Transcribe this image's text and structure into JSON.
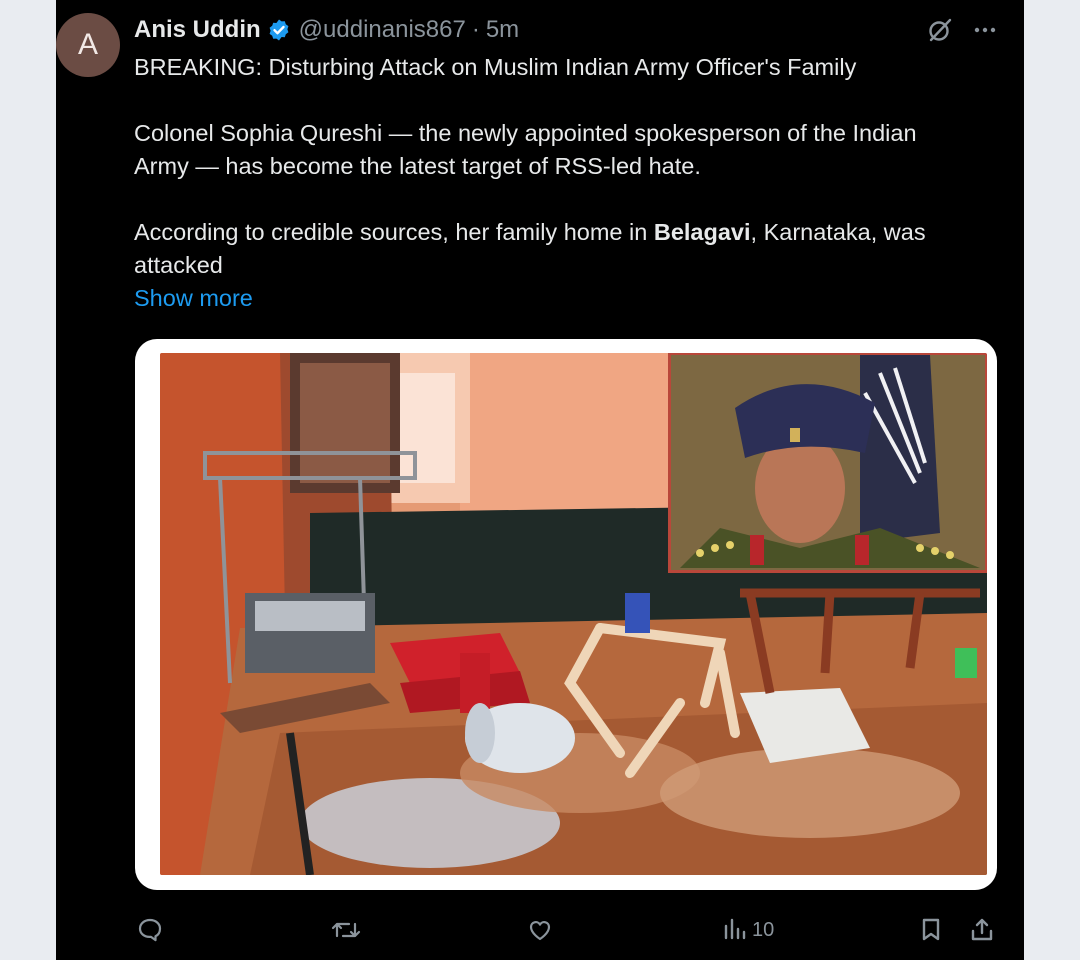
{
  "tweet": {
    "avatar_letter": "A",
    "author_name": "Anis Uddin",
    "handle": "@uddinanis867",
    "separator": "·",
    "time": "5m",
    "headline": "BREAKING: Disturbing Attack on Muslim Indian Army Officer's Family",
    "paragraph2_line1": "Colonel Sophia Qureshi — the newly appointed spokesperson of the Indian",
    "paragraph2_line2": "Army — has become the latest target of RSS-led hate.",
    "paragraph3_pre": "According to credible sources, her family home in ",
    "paragraph3_bold": "Belagavi",
    "paragraph3_post": ", Karnataka, was",
    "paragraph3_line2": "attacked",
    "show_more": "Show more",
    "views_count": "10"
  },
  "icons": {
    "verified": "verified-badge-icon",
    "grok": "grok-icon",
    "more": "more-options-icon",
    "reply": "reply-icon",
    "retweet": "retweet-icon",
    "like": "like-icon",
    "views": "views-icon",
    "bookmark": "bookmark-icon",
    "share": "share-icon"
  },
  "colors": {
    "background": "#000000",
    "text": "#e7e9ea",
    "secondary_text": "#8b949c",
    "link": "#1d9bf0",
    "verified": "#1d9bf0",
    "avatar": "#6b4c44"
  }
}
